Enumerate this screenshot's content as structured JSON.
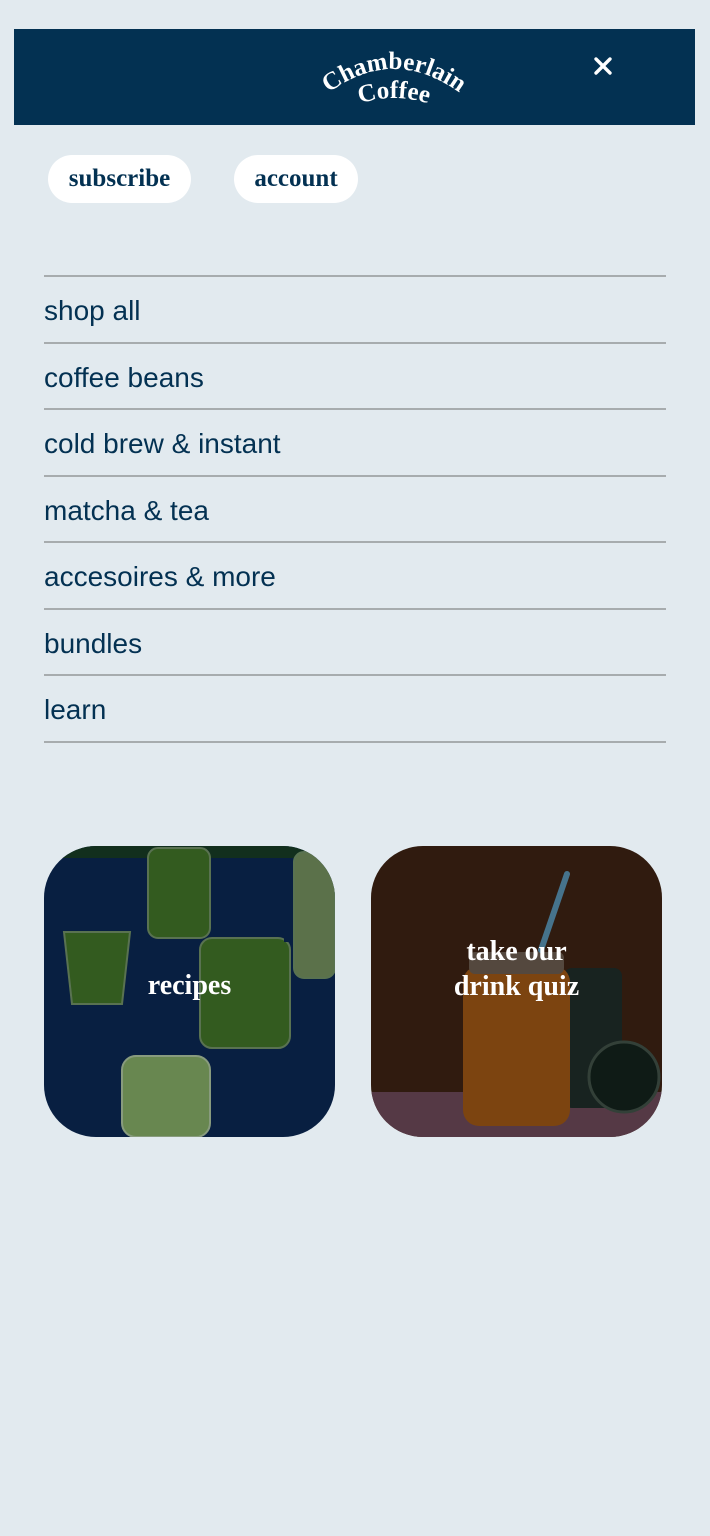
{
  "header": {
    "logo_line1": "Chamberlain",
    "logo_line2": "Coffee",
    "close_icon": "close-icon",
    "background": "#033152"
  },
  "quick_links": {
    "subscribe": "subscribe",
    "account": "account"
  },
  "menu": {
    "items": [
      {
        "label": "shop all"
      },
      {
        "label": "coffee beans"
      },
      {
        "label": "cold brew & instant"
      },
      {
        "label": "matcha & tea"
      },
      {
        "label": "accesoires & more"
      },
      {
        "label": "bundles"
      },
      {
        "label": "learn"
      }
    ]
  },
  "cards": {
    "recipes": {
      "label": "recipes"
    },
    "quiz": {
      "line1": "take our",
      "line2": "drink quiz"
    }
  },
  "colors": {
    "page_background": "#e2eaef",
    "brand_navy": "#033152",
    "divider": "#a7acae",
    "pill_background": "#ffffff"
  }
}
